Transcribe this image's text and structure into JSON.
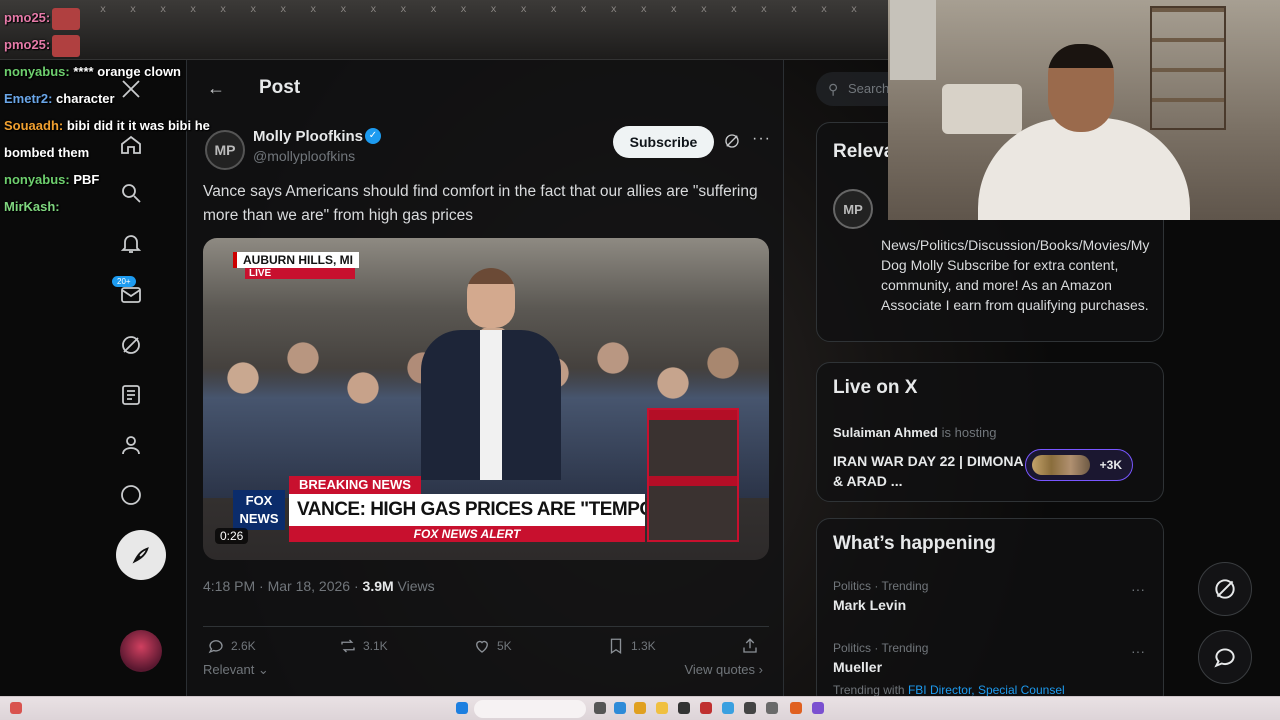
{
  "top_strip": {
    "pattern": "x x x x x x x x x x x x x x x x x x x x x x x x x x x x x x x x x x x x x x x x x"
  },
  "chat": {
    "messages": [
      {
        "user": "pmo25:",
        "text": ""
      },
      {
        "user": "pmo25:",
        "text": ""
      },
      {
        "user": "nonyabus:",
        "text": "**** orange clown"
      },
      {
        "user": "Emetr2:",
        "text": "character"
      },
      {
        "user": "Souaadh:",
        "text": "bibi did it it was bibi he bombed them"
      },
      {
        "user": "nonyabus:",
        "text": "PBF"
      },
      {
        "user": "MirKash:",
        "text": ""
      }
    ]
  },
  "rail": {
    "notif_badge": "20+"
  },
  "post": {
    "header_title": "Post",
    "author_name": "Molly Ploofkins",
    "author_initials": "MP",
    "author_handle": "@mollyploofkins",
    "subscribe_label": "Subscribe",
    "text": "Vance says Americans should find comfort in the fact that our allies are \"suffering more than we are\" from high gas prices",
    "video": {
      "location": "AUBURN HILLS, MI",
      "live_label": "LIVE",
      "breaking_label": "BREAKING NEWS",
      "headline": "VANCE: HIGH GAS PRICES ARE \"TEMPORARY BLIP\"",
      "alert": "FOX NEWS ALERT",
      "logo": "FOX NEWS",
      "duration": "0:26"
    },
    "timestamp": "4:18 PM · Mar 18, 2026 ·",
    "views_count": "3.9M",
    "views_label": "Views",
    "stats": {
      "replies": "2.6K",
      "reposts": "3.1K",
      "likes": "5K",
      "bookmarks": "1.3K"
    },
    "sort_label": "Relevant",
    "view_quotes": "View quotes"
  },
  "right": {
    "search_placeholder": "Search",
    "relevant": {
      "title": "Relevant people",
      "initials": "MP",
      "bio": "News/Politics/Discussion/Books/Movies/My Dog Molly Subscribe for extra content, community, and more! As an Amazon Associate I earn from qualifying purchases."
    },
    "live": {
      "title": "Live on X",
      "host": "Sulaiman Ahmed",
      "host_suffix": "is hosting",
      "space_title": "IRAN WAR DAY 22 | DIMONA & ARAD ...",
      "listeners": "+3K"
    },
    "happening": {
      "title": "What’s happening",
      "trends": [
        {
          "category": "Politics · Trending",
          "name": "Mark Levin"
        },
        {
          "category": "Politics · Trending",
          "name": "Mueller",
          "with_label": "Trending with",
          "with_links": "FBI Director, Special Counsel"
        }
      ]
    }
  },
  "colors": {
    "accent": "#1d9bf0",
    "live_purple": "#7856ff",
    "fox_red": "#c8102e"
  }
}
